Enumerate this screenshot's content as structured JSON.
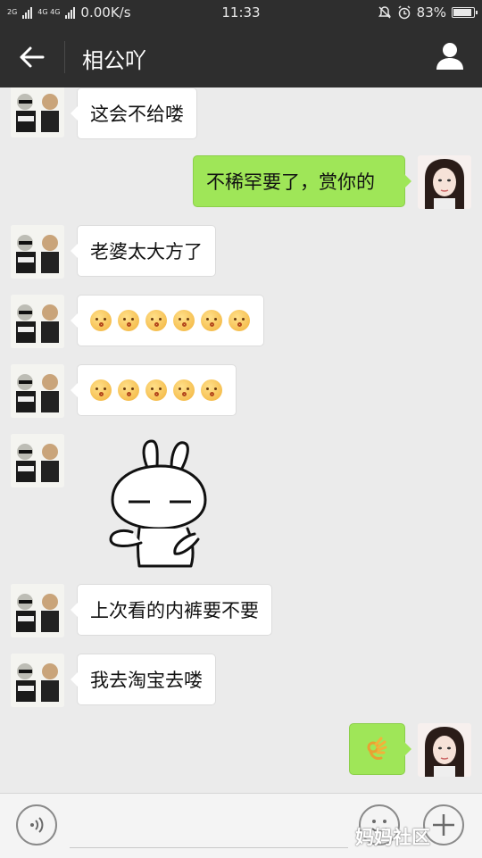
{
  "status_bar": {
    "network_top": "2G",
    "network_type": "4G 4G",
    "speed": "0.00K/s",
    "time": "11:33",
    "battery": "83%",
    "battery_level": 0.83,
    "icons": [
      "signal-icon",
      "alarm-off-icon",
      "alarm-clock-icon",
      "battery-icon"
    ]
  },
  "header": {
    "title": "相公吖",
    "back_icon": "arrow-left-icon",
    "profile_icon": "user-icon"
  },
  "messages": [
    {
      "side": "left",
      "type": "text",
      "text": "这会不给喽"
    },
    {
      "side": "right",
      "type": "text",
      "text": "不稀罕要了，赏你的"
    },
    {
      "side": "left",
      "type": "text",
      "text": "老婆太大方了"
    },
    {
      "side": "left",
      "type": "emoji",
      "emoji": "kissing-face",
      "count": 6
    },
    {
      "side": "left",
      "type": "emoji",
      "emoji": "kissing-face",
      "count": 5
    },
    {
      "side": "left",
      "type": "sticker",
      "sticker": "rabbit-sticker"
    },
    {
      "side": "left",
      "type": "text",
      "text": "上次看的内裤要不要"
    },
    {
      "side": "left",
      "type": "text",
      "text": "我去淘宝去喽"
    },
    {
      "side": "right",
      "type": "emoji",
      "emoji": "ok-hand",
      "count": 1
    }
  ],
  "input_bar": {
    "placeholder": "",
    "voice_icon": "voice-icon",
    "emoji_icon": "emoji-icon",
    "plus_icon": "plus-icon"
  },
  "watermark": "妈妈社区",
  "colors": {
    "bar": "#2e2e2e",
    "chat_bg": "#ebebeb",
    "bubble_out": "#9fe658",
    "bubble_in": "#ffffff"
  }
}
